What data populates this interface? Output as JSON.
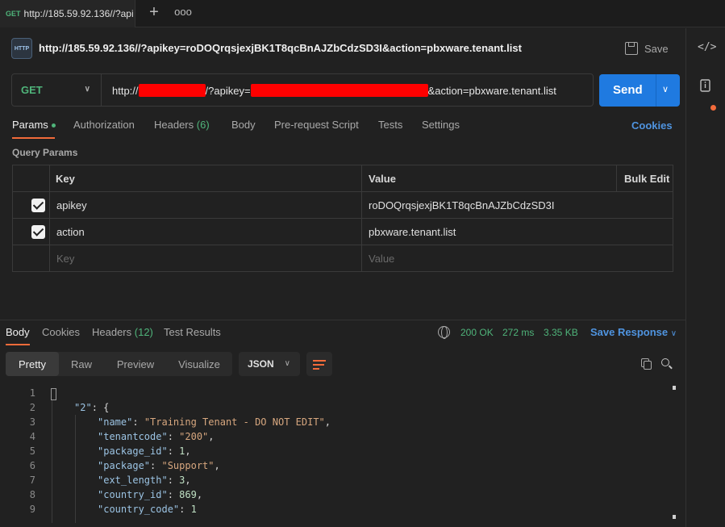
{
  "tab": {
    "method": "GET",
    "title": "http://185.59.92.136//?api"
  },
  "request": {
    "icon_label": "HTTP",
    "title": "http://185.59.92.136//?apikey=roDOQrqsjexjBK1T8qcBnAJZbCdzSD3I&action=pbxware.tenant.list",
    "save_label": "Save",
    "method": "GET",
    "url_prefix": "http://",
    "url_middle": "/?apikey=",
    "url_suffix": "&action=pbxware.tenant.list",
    "send_label": "Send"
  },
  "request_tabs": [
    {
      "label": "Params"
    },
    {
      "label": "Authorization"
    },
    {
      "label": "Headers",
      "count": "(6)"
    },
    {
      "label": "Body"
    },
    {
      "label": "Pre-request Script"
    },
    {
      "label": "Tests"
    },
    {
      "label": "Settings"
    }
  ],
  "cookies_label": "Cookies",
  "query_params": {
    "title": "Query Params",
    "headers": {
      "key": "Key",
      "value": "Value",
      "bulk": "Bulk Edit"
    },
    "rows": [
      {
        "key": "apikey",
        "value": "roDOQrqsjexjBK1T8qcBnAJZbCdzSD3I"
      },
      {
        "key": "action",
        "value": "pbxware.tenant.list"
      }
    ],
    "placeholder": {
      "key": "Key",
      "value": "Value"
    }
  },
  "response": {
    "tabs": [
      {
        "label": "Body"
      },
      {
        "label": "Cookies"
      },
      {
        "label": "Headers",
        "count": "(12)"
      },
      {
        "label": "Test Results"
      }
    ],
    "status": "200 OK",
    "time": "272 ms",
    "size": "3.35 KB",
    "save_label": "Save Response",
    "modes": [
      "Pretty",
      "Raw",
      "Preview",
      "Visualize"
    ],
    "format": "JSON",
    "lines": [
      "1",
      "2",
      "3",
      "4",
      "5",
      "6",
      "7",
      "8",
      "9"
    ],
    "code": {
      "l2_key": "\"2\"",
      "fields": [
        {
          "key": "\"name\"",
          "value": "\"Training Tenant - DO NOT EDIT\"",
          "type": "s"
        },
        {
          "key": "\"tenantcode\"",
          "value": "\"200\"",
          "type": "s"
        },
        {
          "key": "\"package_id\"",
          "value": "1",
          "type": "n"
        },
        {
          "key": "\"package\"",
          "value": "\"Support\"",
          "type": "s"
        },
        {
          "key": "\"ext_length\"",
          "value": "3",
          "type": "n"
        },
        {
          "key": "\"country_id\"",
          "value": "869",
          "type": "n"
        },
        {
          "key": "\"country_code\"",
          "value": "1",
          "type": "n"
        }
      ]
    }
  },
  "icons": {
    "code": "code-icon",
    "info": "document-info-icon"
  }
}
